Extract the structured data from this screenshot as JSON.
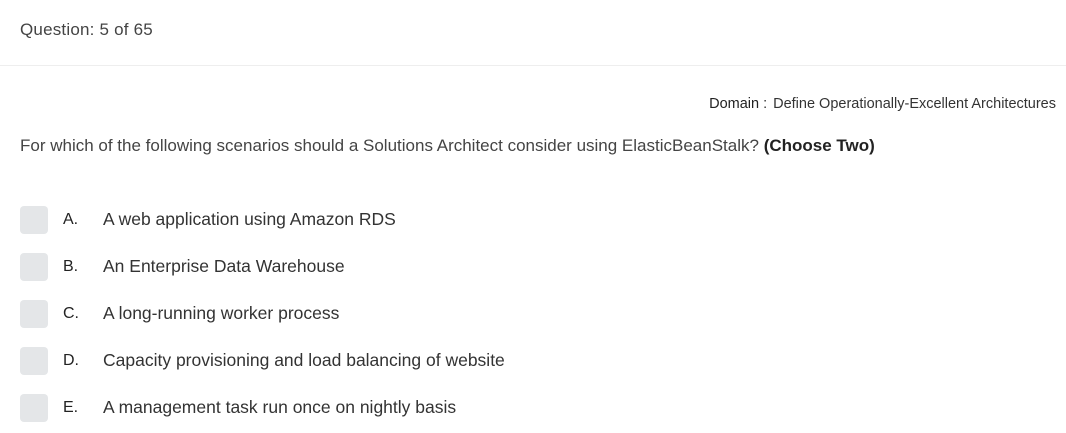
{
  "header": {
    "question_counter": "Question: 5 of 65"
  },
  "domain": {
    "label": "Domain",
    "separator": ":",
    "value": "Define Operationally-Excellent Architectures"
  },
  "question": {
    "text": "For which of the following scenarios should a Solutions Architect consider using ElasticBeanStalk?",
    "choose": "(Choose Two)"
  },
  "options": [
    {
      "letter": "A.",
      "text": "A web application using Amazon RDS"
    },
    {
      "letter": "B.",
      "text": "An Enterprise Data Warehouse"
    },
    {
      "letter": "C.",
      "text": "A long-running worker process"
    },
    {
      "letter": "D.",
      "text": "Capacity provisioning and load balancing of website"
    },
    {
      "letter": "E.",
      "text": "A management task run once on nightly basis"
    }
  ]
}
